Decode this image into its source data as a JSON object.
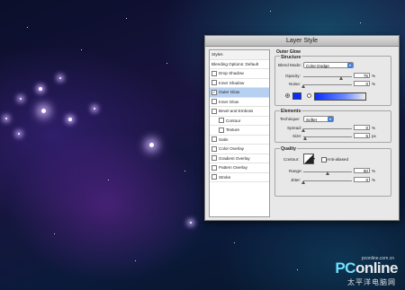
{
  "dialog": {
    "title": "Layer Style"
  },
  "styles_panel": {
    "header": "Styles",
    "blending": "Blending Options: Default",
    "items": [
      {
        "label": "Drop Shadow",
        "checked": false
      },
      {
        "label": "Inner Shadow",
        "checked": false
      },
      {
        "label": "Outer Glow",
        "checked": true
      },
      {
        "label": "Inner Glow",
        "checked": false
      },
      {
        "label": "Bevel and Emboss",
        "checked": false
      },
      {
        "label": "Contour",
        "checked": false
      },
      {
        "label": "Texture",
        "checked": false
      },
      {
        "label": "Satin",
        "checked": false
      },
      {
        "label": "Color Overlay",
        "checked": false
      },
      {
        "label": "Gradient Overlay",
        "checked": false
      },
      {
        "label": "Pattern Overlay",
        "checked": false
      },
      {
        "label": "Stroke",
        "checked": false
      }
    ]
  },
  "outer_glow": {
    "title": "Outer Glow",
    "structure": {
      "title": "Structure",
      "blend_mode_label": "Blend Mode:",
      "blend_mode_value": "Color Dodge",
      "opacity_label": "Opacity:",
      "opacity_value": "75",
      "opacity_unit": "%",
      "noise_label": "Noise:",
      "noise_value": "0",
      "noise_unit": "%",
      "glow_color": "#0b2cff"
    },
    "elements": {
      "title": "Elements",
      "technique_label": "Technique:",
      "technique_value": "Softer",
      "spread_label": "Spread:",
      "spread_value": "0",
      "spread_unit": "%",
      "size_label": "Size:",
      "size_value": "5",
      "size_unit": "px"
    },
    "quality": {
      "title": "Quality",
      "contour_label": "Contour:",
      "anti_alias_label": "Anti-aliased",
      "range_label": "Range:",
      "range_value": "50",
      "range_unit": "%",
      "jitter_label": "Jitter:",
      "jitter_value": "0",
      "jitter_unit": "%"
    }
  },
  "watermark": {
    "brand_prefix": "PC",
    "brand_suffix": "online",
    "url": "pconline.com.cn",
    "cn": "太平洋电脑网"
  }
}
